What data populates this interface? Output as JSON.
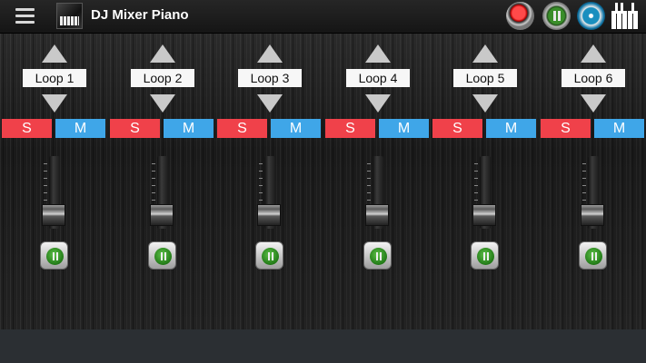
{
  "appbar": {
    "title": "DJ Mixer Piano",
    "icons": [
      "menu-icon",
      "app-logo",
      "record-icon",
      "pause-icon",
      "disc-icon",
      "piano-icon"
    ]
  },
  "channels": [
    {
      "loop_label": "Loop 1",
      "solo_label": "S",
      "mute_label": "M"
    },
    {
      "loop_label": "Loop 2",
      "solo_label": "S",
      "mute_label": "M"
    },
    {
      "loop_label": "Loop 3",
      "solo_label": "S",
      "mute_label": "M"
    },
    {
      "loop_label": "Loop 4",
      "solo_label": "S",
      "mute_label": "M"
    },
    {
      "loop_label": "Loop 5",
      "solo_label": "S",
      "mute_label": "M"
    },
    {
      "loop_label": "Loop 6",
      "solo_label": "S",
      "mute_label": "M"
    }
  ],
  "colors": {
    "solo": "#f0414a",
    "mute": "#3fa6e8",
    "record": "#e01010",
    "play": "#2e8a22",
    "disc": "#1a8fbf"
  }
}
